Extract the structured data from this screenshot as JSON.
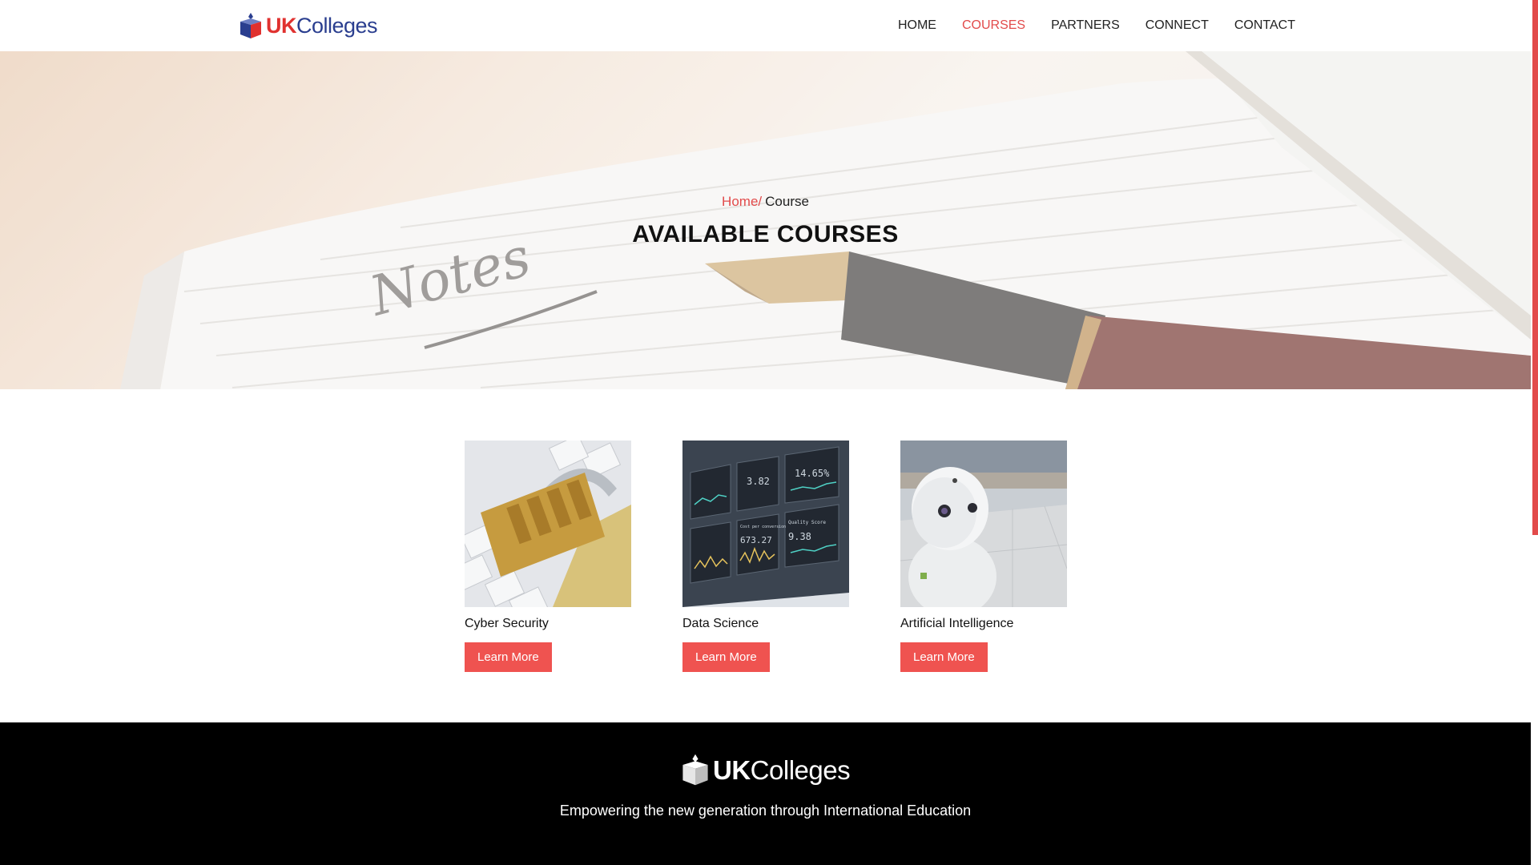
{
  "brand": {
    "uk": "UK",
    "colleges": "Colleges"
  },
  "nav": {
    "items": [
      {
        "label": "HOME"
      },
      {
        "label": "COURSES"
      },
      {
        "label": "PARTNERS"
      },
      {
        "label": "CONNECT"
      },
      {
        "label": "CONTACT"
      }
    ],
    "active": "COURSES"
  },
  "hero": {
    "breadcrumb_home": "Home",
    "breadcrumb_separator": "/",
    "breadcrumb_current": "Course",
    "title": "AVAILABLE COURSES",
    "image_text": "Notes"
  },
  "courses": [
    {
      "title": "Cyber Security",
      "button": "Learn More"
    },
    {
      "title": "Data Science",
      "button": "Learn More"
    },
    {
      "title": "Artificial Intelligence",
      "button": "Learn More"
    }
  ],
  "data_screen": {
    "value_1": "14.65%",
    "value_2": "3.82",
    "value_3": "673.27",
    "label_3": "Cost per conversion",
    "value_4": "9.38",
    "label_4": "Quality Score"
  },
  "footer": {
    "tagline": "Empowering the new generation through International Education"
  },
  "colors": {
    "accent": "#e24b4b",
    "button": "#ef5350",
    "brand_red": "#e0312f",
    "brand_blue": "#2a3e8f",
    "footer_bg": "#000000"
  }
}
